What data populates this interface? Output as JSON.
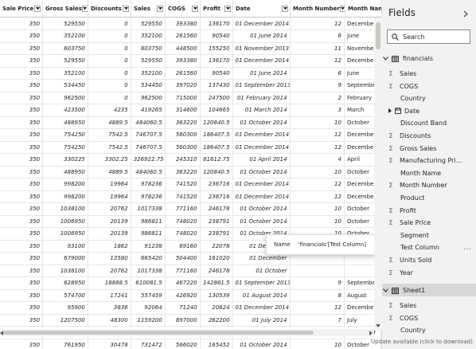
{
  "grid": {
    "columns": [
      {
        "label": "Sale Price",
        "width": 54
      },
      {
        "label": "Gross Sales",
        "width": 57
      },
      {
        "label": "Discounts",
        "width": 54
      },
      {
        "label": "Sales",
        "width": 43
      },
      {
        "label": "COGS",
        "width": 44
      },
      {
        "label": "Profit",
        "width": 41
      },
      {
        "label": "Date",
        "width": 72
      },
      {
        "label": "Month Number",
        "width": 69
      },
      {
        "label": "Month Name",
        "width": 46
      }
    ],
    "rows": [
      [
        "350",
        "529550",
        "0",
        "529550",
        "393380",
        "136170",
        "01 December 2014",
        "12",
        "December"
      ],
      [
        "350",
        "352100",
        "0",
        "352100",
        "261560",
        "90540",
        "01 June 2014",
        "6",
        "June"
      ],
      [
        "350",
        "603750",
        "0",
        "603750",
        "448500",
        "155250",
        "01 November 2013",
        "11",
        "November"
      ],
      [
        "350",
        "529550",
        "0",
        "529550",
        "393380",
        "136170",
        "01 December 2014",
        "12",
        "December"
      ],
      [
        "350",
        "352100",
        "0",
        "352100",
        "261560",
        "90540",
        "01 June 2014",
        "6",
        "June"
      ],
      [
        "350",
        "534450",
        "0",
        "534450",
        "397020",
        "137430",
        "01 September 2013",
        "9",
        "September"
      ],
      [
        "350",
        "962500",
        "0",
        "962500",
        "715000",
        "247500",
        "01 February 2014",
        "2",
        "February"
      ],
      [
        "350",
        "423500",
        "4235",
        "419265",
        "314600",
        "104665",
        "01 March 2014",
        "3",
        "March"
      ],
      [
        "350",
        "488950",
        "4889.5",
        "484060.5",
        "363220",
        "120840.5",
        "01 October 2014",
        "10",
        "October"
      ],
      [
        "350",
        "754250",
        "7542.5",
        "746707.5",
        "560300",
        "186407.5",
        "01 December 2014",
        "12",
        "December"
      ],
      [
        "350",
        "754250",
        "7542.5",
        "746707.5",
        "560300",
        "186407.5",
        "01 December 2014",
        "12",
        "December"
      ],
      [
        "350",
        "330225",
        "3302.25",
        "326922.75",
        "245310",
        "81612.75",
        "01 April 2014",
        "4",
        "April"
      ],
      [
        "350",
        "488950",
        "4889.5",
        "484060.5",
        "363220",
        "120840.5",
        "01 October 2014",
        "10",
        "October"
      ],
      [
        "350",
        "998200",
        "19964",
        "978236",
        "741520",
        "236716",
        "01 December 2014",
        "12",
        "December"
      ],
      [
        "350",
        "998200",
        "19964",
        "978236",
        "741520",
        "236716",
        "01 December 2014",
        "12",
        "December"
      ],
      [
        "350",
        "1038100",
        "20762",
        "1017338",
        "771160",
        "246178",
        "01 October 2014",
        "10",
        "October"
      ],
      [
        "350",
        "1006950",
        "20139",
        "986811",
        "748020",
        "238791",
        "01 October 2014",
        "10",
        "October"
      ],
      [
        "350",
        "1006950",
        "20139",
        "986811",
        "748020",
        "238791",
        "01 October 2014",
        "10",
        "October"
      ],
      [
        "350",
        "93100",
        "1862",
        "91238",
        "69160",
        "22078",
        "01 December",
        "",
        ""
      ],
      [
        "350",
        "679000",
        "13580",
        "665420",
        "504400",
        "161020",
        "01 December",
        "",
        ""
      ],
      [
        "350",
        "1038100",
        "20762",
        "1017338",
        "771160",
        "246178",
        "01 October",
        "",
        ""
      ],
      [
        "350",
        "628950",
        "18868.5",
        "610081.5",
        "467220",
        "142861.5",
        "01 September 2013",
        "9",
        "September"
      ],
      [
        "350",
        "574700",
        "17241",
        "557459",
        "426920",
        "130539",
        "01 August 2014",
        "8",
        "August"
      ],
      [
        "350",
        "95900",
        "3836",
        "92064",
        "71240",
        "20824",
        "01 December 2014",
        "12",
        "December"
      ],
      [
        "350",
        "1207500",
        "48300",
        "1159200",
        "897000",
        "262200",
        "01 July 2014",
        "7",
        "July"
      ],
      [
        "350",
        "95900",
        "3836",
        "92064",
        "71240",
        "20824",
        "01 December 2014",
        "12",
        "December"
      ],
      [
        "350",
        "761950",
        "30478",
        "731472",
        "566020",
        "165452",
        "01 October 2014",
        "10",
        "October"
      ]
    ]
  },
  "tooltip": {
    "key": "Name",
    "value": "'financials'[Test Column]"
  },
  "fields_pane": {
    "title": "Fields",
    "search_placeholder": "Search",
    "tables": [
      {
        "name": "financials",
        "fields": [
          {
            "label": "Sales",
            "kind": "sigma"
          },
          {
            "label": "COGS",
            "kind": "sigma"
          },
          {
            "label": "Country",
            "kind": "text"
          },
          {
            "label": "Date",
            "kind": "date"
          },
          {
            "label": "Discount Band",
            "kind": "text"
          },
          {
            "label": "Discounts",
            "kind": "sigma"
          },
          {
            "label": "Gross Sales",
            "kind": "sigma"
          },
          {
            "label": "Manufacturing Pri...",
            "kind": "sigma"
          },
          {
            "label": "Month Name",
            "kind": "text"
          },
          {
            "label": "Month Number",
            "kind": "sigma"
          },
          {
            "label": "Product",
            "kind": "text"
          },
          {
            "label": "Profit",
            "kind": "sigma"
          },
          {
            "label": "Sale Price",
            "kind": "sigma"
          },
          {
            "label": "Segment",
            "kind": "text"
          },
          {
            "label": "Test Column",
            "kind": "text",
            "more": "..."
          },
          {
            "label": "Units Sold",
            "kind": "sigma"
          },
          {
            "label": "Year",
            "kind": "sigma"
          }
        ]
      },
      {
        "name": "Sheet1",
        "fields": [
          {
            "label": "Sales",
            "kind": "sigma"
          },
          {
            "label": "COGS",
            "kind": "sigma"
          },
          {
            "label": "Country",
            "kind": "text"
          }
        ]
      }
    ]
  },
  "status": {
    "update_text": "Update available (click to download)"
  },
  "colors": {
    "pane_bg": "#f3f2f1",
    "grid_border": "#e6e6e6",
    "selected_table_bg": "#d8d8d8",
    "text": "#252423"
  },
  "icons": {
    "search": "search-icon",
    "collapse": "chevron-right-icon",
    "table": "table-icon",
    "sigma": "sigma-icon",
    "calendar": "calendar-icon",
    "dropdown": "dropdown-arrow-icon"
  }
}
